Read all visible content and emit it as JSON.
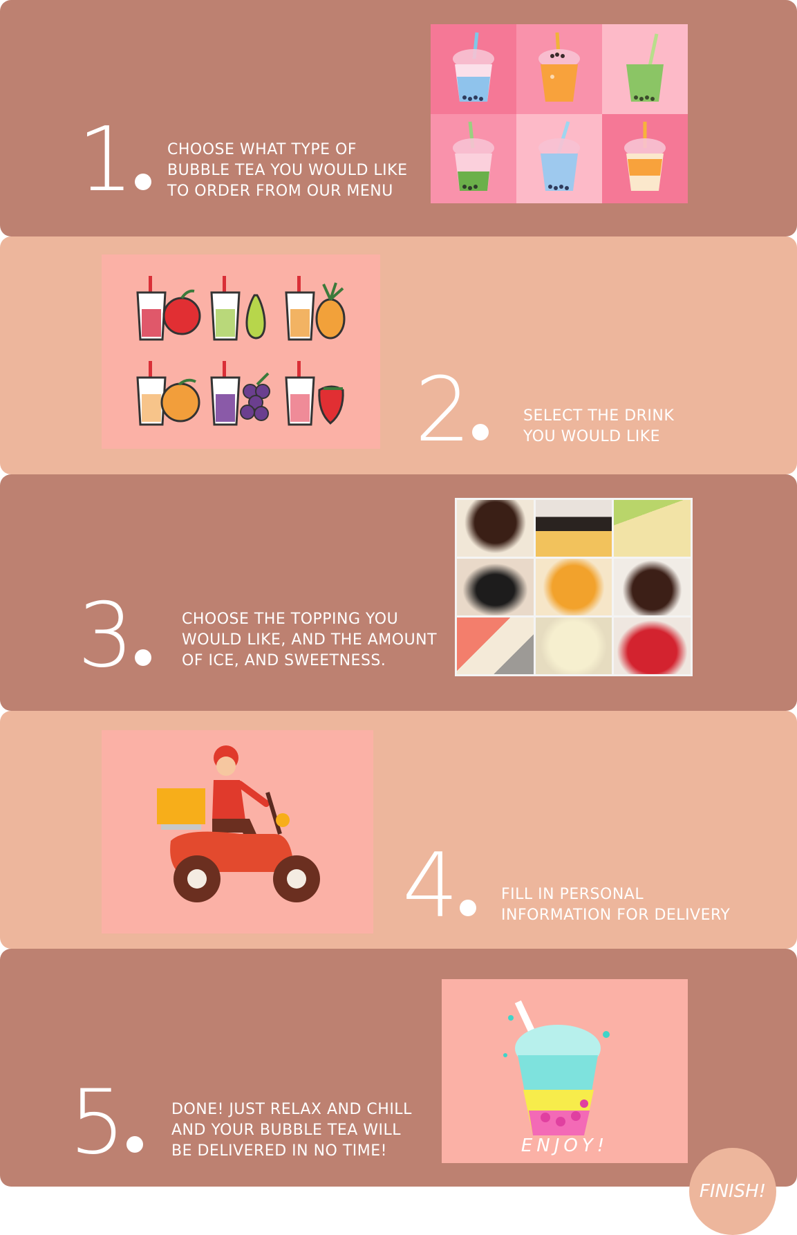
{
  "colors": {
    "dark_panel": "#bd8171",
    "light_panel": "#edb69c",
    "pink_card": "#fbb1a6",
    "white": "#ffffff"
  },
  "steps": [
    {
      "number": "1",
      "text_lines": [
        "CHOOSE WHAT TYPE OF",
        "BUBBLE TEA YOU WOULD LIKE",
        "TO ORDER FROM OUR MENU"
      ]
    },
    {
      "number": "2",
      "text_lines": [
        "SELECT THE DRINK",
        "YOU WOULD LIKE"
      ]
    },
    {
      "number": "3",
      "text_lines": [
        "CHOOSE THE TOPPING YOU",
        "WOULD LIKE, AND THE AMOUNT",
        "OF ICE, AND SWEETNESS."
      ]
    },
    {
      "number": "4",
      "text_lines": [
        "FILL IN PERSONAL",
        "INFORMATION FOR DELIVERY"
      ]
    },
    {
      "number": "5",
      "text_lines": [
        "DONE! JUST RELAX AND CHILL",
        "AND YOUR BUBBLE TEA WILL",
        "BE DELIVERED IN NO TIME!"
      ]
    }
  ],
  "enjoy_label": "ENJOY!",
  "finish_label": "FINISH!",
  "icons": [
    "bubble-tea-cup-icon",
    "fruit-tea-icon",
    "topping-photo",
    "delivery-scooter-icon",
    "enjoy-drink-icon"
  ]
}
